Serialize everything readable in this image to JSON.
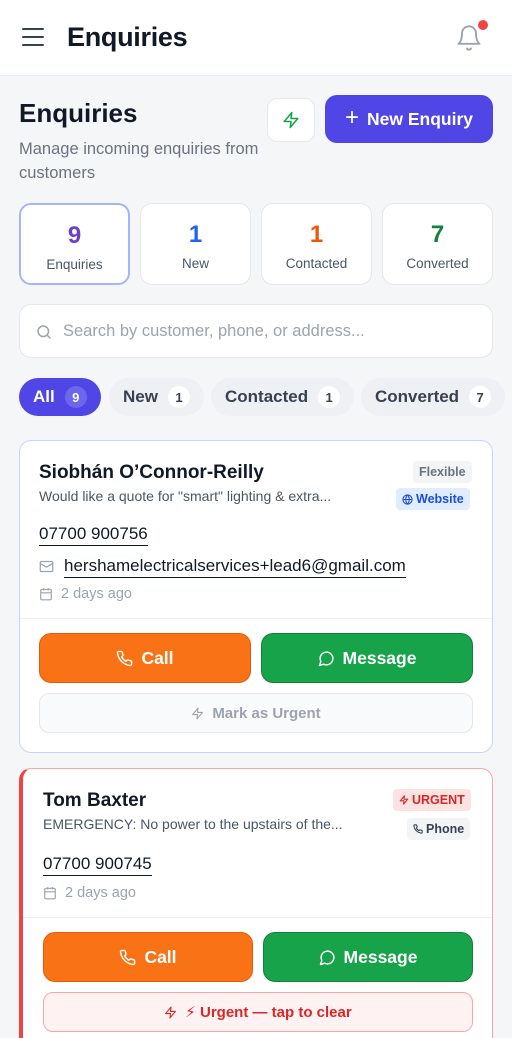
{
  "topbar": {
    "title": "Enquiries"
  },
  "header": {
    "title": "Enquiries",
    "subtitle": "Manage incoming enquiries from customers",
    "new_button": "New Enquiry"
  },
  "stats": [
    {
      "value": "9",
      "label": "Enquiries",
      "color": "#6d3fc7"
    },
    {
      "value": "1",
      "label": "New",
      "color": "#2563eb"
    },
    {
      "value": "1",
      "label": "Contacted",
      "color": "#ea580c"
    },
    {
      "value": "7",
      "label": "Converted",
      "color": "#15803d"
    }
  ],
  "search": {
    "placeholder": "Search by customer, phone, or address..."
  },
  "filters": [
    {
      "label": "All",
      "count": "9"
    },
    {
      "label": "New",
      "count": "1"
    },
    {
      "label": "Contacted",
      "count": "1"
    },
    {
      "label": "Converted",
      "count": "7"
    }
  ],
  "enquiries": [
    {
      "name": "Siobhán O’Connor-Reilly",
      "description": "Would like a quote for \"smart\" lighting & extra...",
      "timing_tag": "Flexible",
      "source_tag": "Website",
      "phone": "07700 900756",
      "email": "hershamelectricalservices+lead6@gmail.com",
      "date": "2 days ago",
      "call_label": "Call",
      "message_label": "Message",
      "urgent_action": "Mark as Urgent"
    },
    {
      "name": "Tom Baxter",
      "description": "EMERGENCY: No power to the upstairs of the...",
      "timing_tag": "URGENT",
      "source_tag": "Phone",
      "phone": "07700 900745",
      "date": "2 days ago",
      "call_label": "Call",
      "message_label": "Message",
      "urgent_action": "⚡ Urgent — tap to clear"
    }
  ],
  "colors": {
    "accent": "#4f46e5",
    "call": "#f97316",
    "message": "#16a34a",
    "urgent": "#ef4444"
  }
}
